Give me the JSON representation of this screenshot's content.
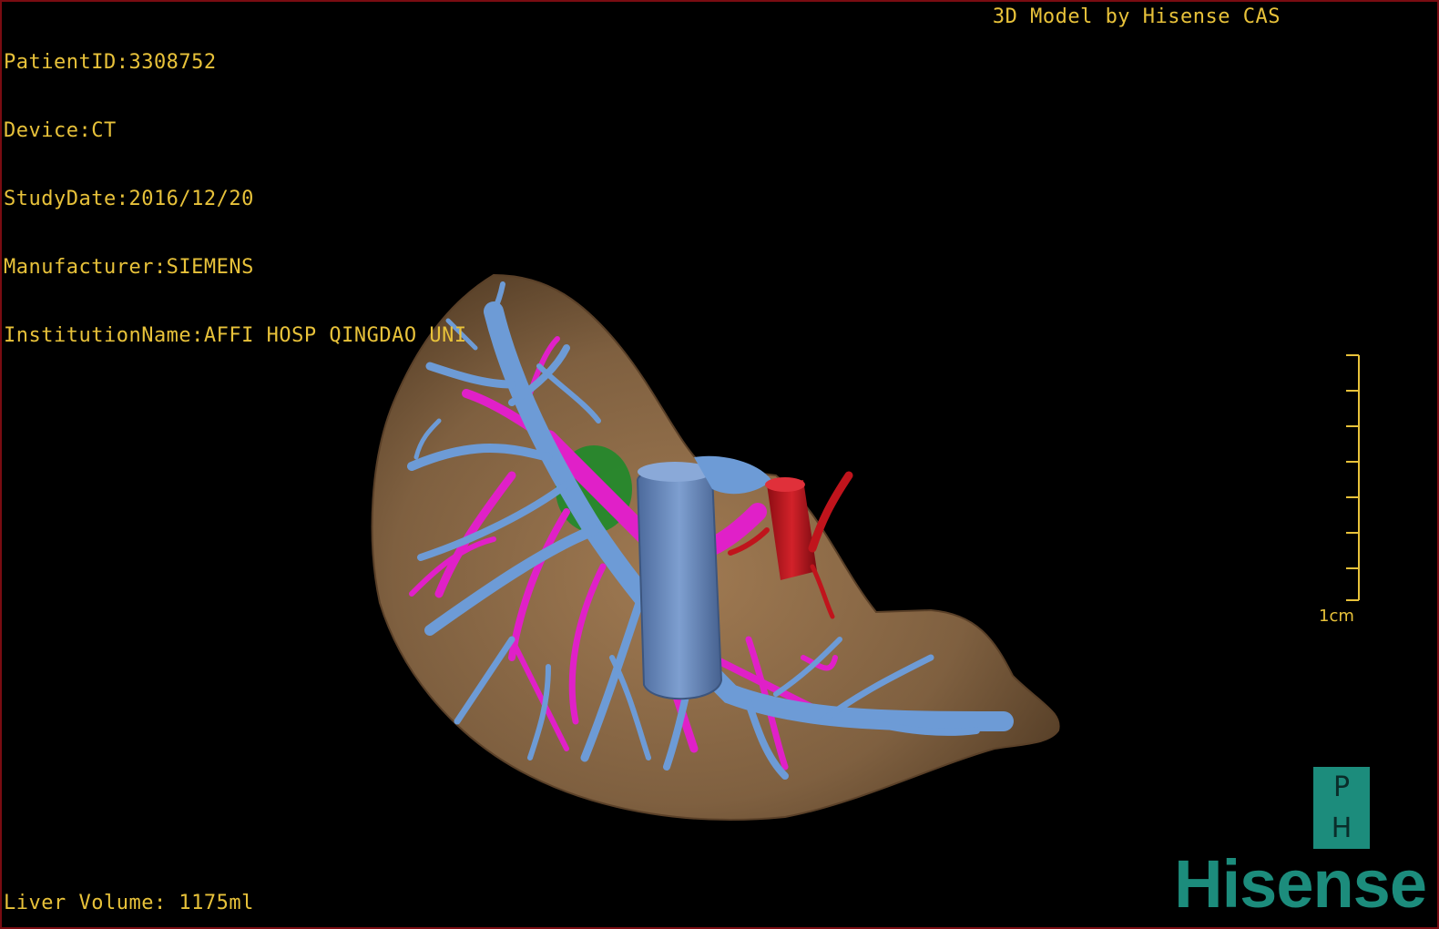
{
  "study_info": {
    "patient_id": "PatientID:3308752",
    "device": "Device:CT",
    "study_date": "StudyDate:2016/12/20",
    "manufacturer": "Manufacturer:SIEMENS",
    "institution": "InstitutionName:AFFI HOSP QINGDAO UNI"
  },
  "credit": "3D Model by Hisense CAS",
  "liver_volume": "Liver Volume: 1175ml",
  "scale_bar": {
    "label": "1cm"
  },
  "logo": {
    "badge_letters": [
      "P",
      "H"
    ],
    "brand_name": "Hisense"
  },
  "colors": {
    "overlay_text": "#e8c23a",
    "liver_surface": "#8a6a45",
    "portal_vein": "#6d9bd6",
    "hepatic_vein": "#e020c8",
    "gallbladder": "#1f8a2a",
    "artery": "#c0141c",
    "brand_teal": "#1c8c7c"
  },
  "model_structures": [
    "liver-surface",
    "portal-vein",
    "hepatic-veins",
    "gallbladder",
    "hepatic-artery"
  ]
}
